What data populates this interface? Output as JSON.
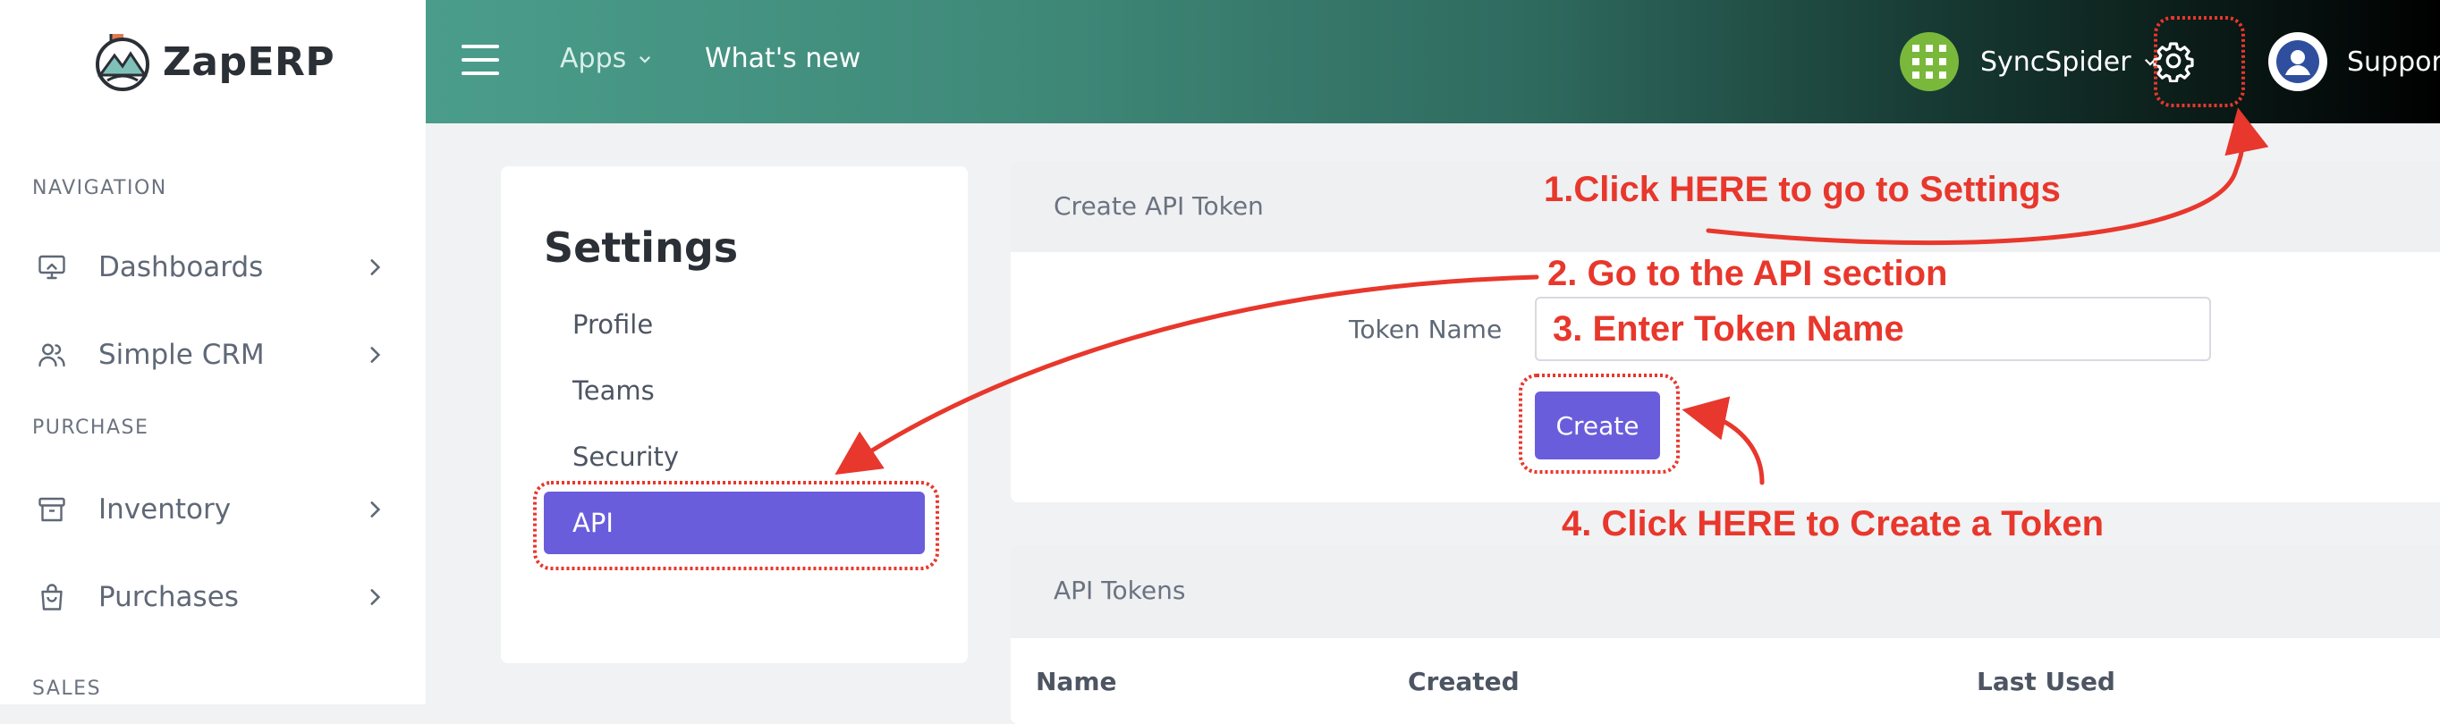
{
  "brand": {
    "name": "ZapERP"
  },
  "sidebar": {
    "sections": [
      {
        "title": "NAVIGATION"
      },
      {
        "title": "PURCHASE"
      },
      {
        "title": "SALES"
      }
    ],
    "items": [
      {
        "label": "Dashboards",
        "icon": "monitor-icon"
      },
      {
        "label": "Simple CRM",
        "icon": "users-icon"
      },
      {
        "label": "Inventory",
        "icon": "archive-box-icon"
      },
      {
        "label": "Purchases",
        "icon": "shopping-bag-icon"
      }
    ]
  },
  "topbar": {
    "apps_label": "Apps",
    "whats_new_label": "What's new",
    "org_name": "SyncSpider",
    "support_label": "Support"
  },
  "settings": {
    "title": "Settings",
    "links": [
      "Profile",
      "Teams",
      "Security",
      "API"
    ],
    "active_link": "API",
    "accent_color": "#6a5ddc"
  },
  "create_token": {
    "header": "Create API Token",
    "field_label": "Token Name",
    "field_value": "3. Enter Token Name",
    "button_label": "Create"
  },
  "api_tokens": {
    "header": "API Tokens",
    "columns": [
      "Name",
      "Created",
      "Last Used"
    ]
  },
  "annotations": {
    "step1": "1.Click HERE to go to Settings",
    "step2": "2. Go to the API section",
    "step4": "4. Click HERE to Create a Token",
    "color": "#e8372c"
  }
}
